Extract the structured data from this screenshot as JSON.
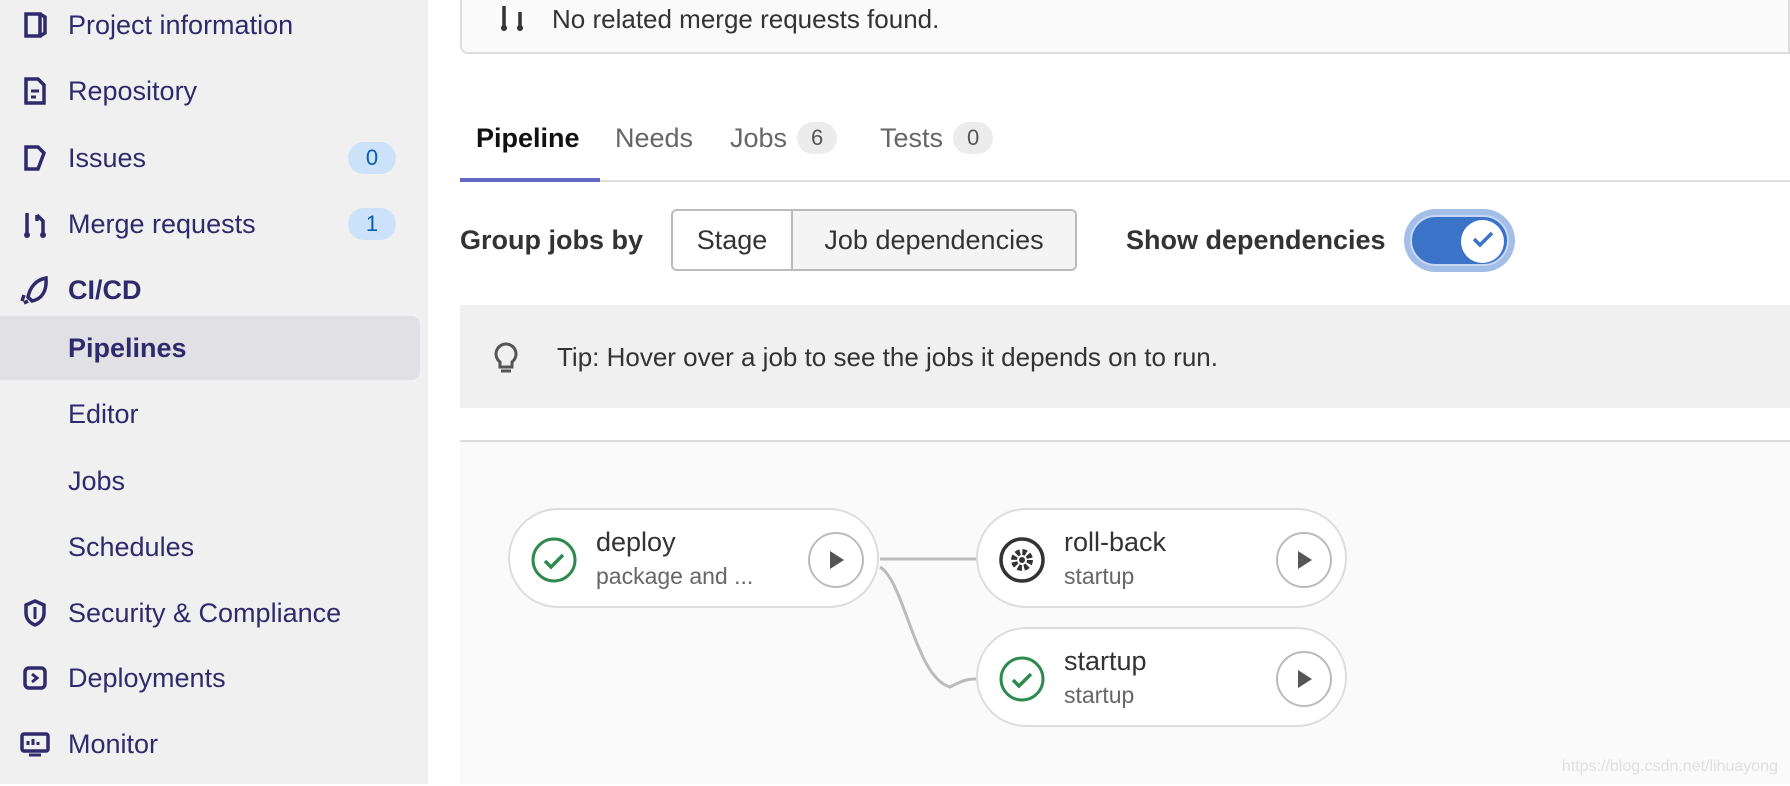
{
  "sidebar": {
    "items": [
      {
        "label": "Project information",
        "icon": "project-icon"
      },
      {
        "label": "Repository",
        "icon": "document-icon"
      },
      {
        "label": "Issues",
        "icon": "issues-icon",
        "badge": "0"
      },
      {
        "label": "Merge requests",
        "icon": "merge-request-icon",
        "badge": "1"
      },
      {
        "label": "CI/CD",
        "icon": "rocket-icon"
      },
      {
        "label": "Pipelines",
        "active": true
      },
      {
        "label": "Editor"
      },
      {
        "label": "Jobs"
      },
      {
        "label": "Schedules"
      },
      {
        "label": "Security & Compliance",
        "icon": "shield-icon"
      },
      {
        "label": "Deployments",
        "icon": "deployments-icon"
      },
      {
        "label": "Monitor",
        "icon": "monitor-icon"
      }
    ]
  },
  "merge_requests_box": {
    "text": "No related merge requests found."
  },
  "tabs": [
    {
      "label": "Pipeline",
      "active": true
    },
    {
      "label": "Needs"
    },
    {
      "label": "Jobs",
      "count": "6"
    },
    {
      "label": "Tests",
      "count": "0"
    }
  ],
  "toolbar": {
    "group_label": "Group jobs by",
    "options": [
      "Stage",
      "Job dependencies"
    ],
    "selected": "Job dependencies",
    "show_dependencies_label": "Show dependencies",
    "show_dependencies": true
  },
  "tip": {
    "text": "Tip: Hover over a job to see the jobs it depends on to run."
  },
  "jobs": [
    {
      "name": "deploy",
      "stage": "package and ...",
      "status": "success"
    },
    {
      "name": "roll-back",
      "stage": "startup",
      "status": "manual"
    },
    {
      "name": "startup",
      "stage": "startup",
      "status": "success"
    }
  ],
  "colors": {
    "accent": "#6666c4",
    "toggle": "#3a73c8",
    "success": "#2f8a4e",
    "sidebar_text": "#2f2a6b"
  },
  "watermark": "https://blog.csdn.net/lihuayong"
}
